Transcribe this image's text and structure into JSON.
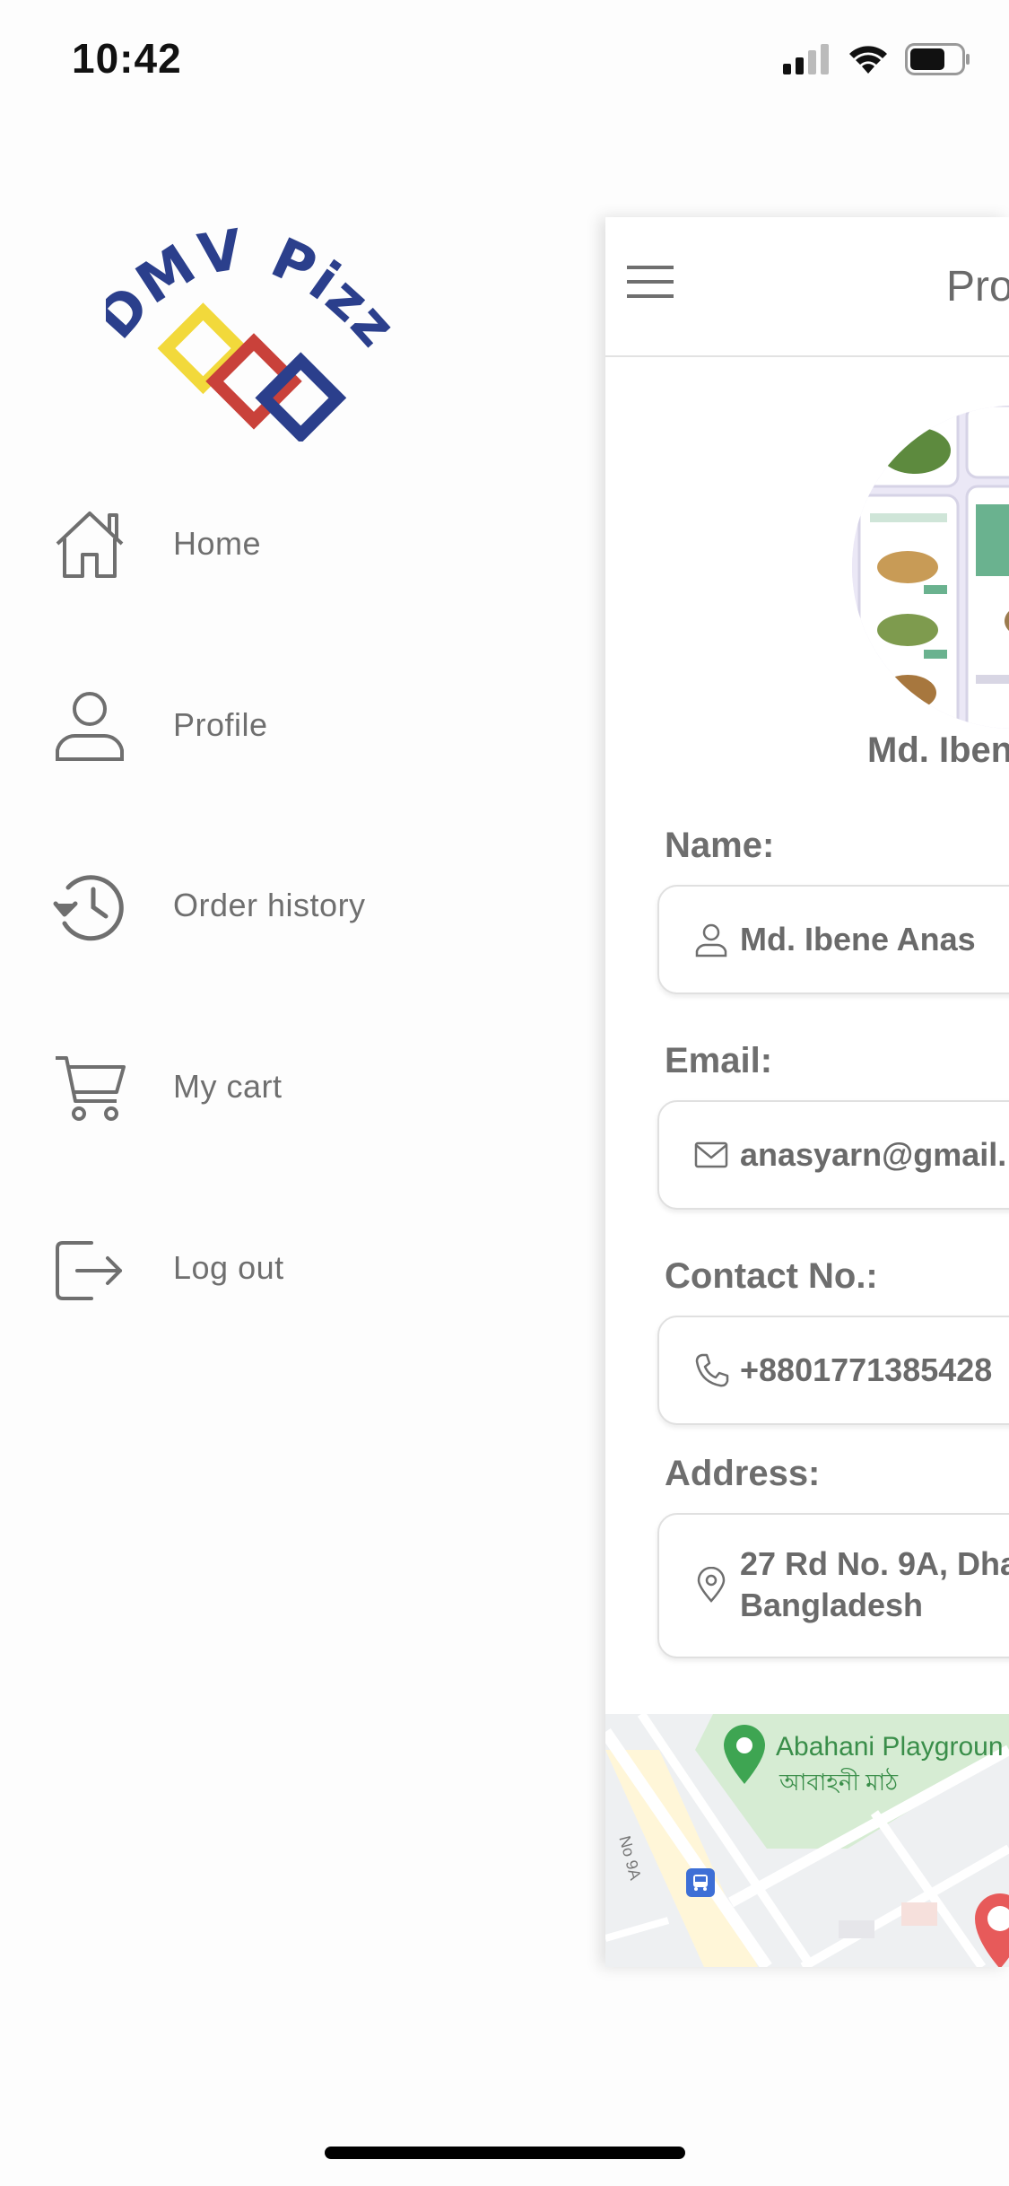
{
  "status_bar": {
    "time": "10:42"
  },
  "drawer": {
    "logo_text": "DMV Pizza",
    "menu": [
      {
        "label": "Home",
        "icon": "home-icon"
      },
      {
        "label": "Profile",
        "icon": "person-icon"
      },
      {
        "label": "Order history",
        "icon": "history-icon"
      },
      {
        "label": "My cart",
        "icon": "cart-icon"
      },
      {
        "label": "Log out",
        "icon": "logout-icon"
      }
    ]
  },
  "profile": {
    "header_title": "Pro",
    "display_name": "Md. Iben",
    "fields": {
      "name": {
        "label": "Name:",
        "value": "Md. Ibene Anas"
      },
      "email": {
        "label": "Email:",
        "value": "anasyarn@gmail."
      },
      "contact": {
        "label": "Contact No.:",
        "value": "+8801771385428"
      },
      "address": {
        "label": "Address:",
        "line1": "27 Rd No. 9A, Dha",
        "line2": "Bangladesh"
      }
    },
    "map": {
      "place_name": "Abahani Playgroun",
      "place_name_bn": "আবাহনী মাঠ",
      "road_label": "No 9A"
    }
  },
  "colors": {
    "text_gray": "#6f6f6f",
    "logo_blue": "#2b3f8c",
    "logo_red": "#c9413a",
    "logo_yellow": "#f2d93b",
    "map_green": "#3a8e4a",
    "pin_red": "#e75a5a"
  }
}
